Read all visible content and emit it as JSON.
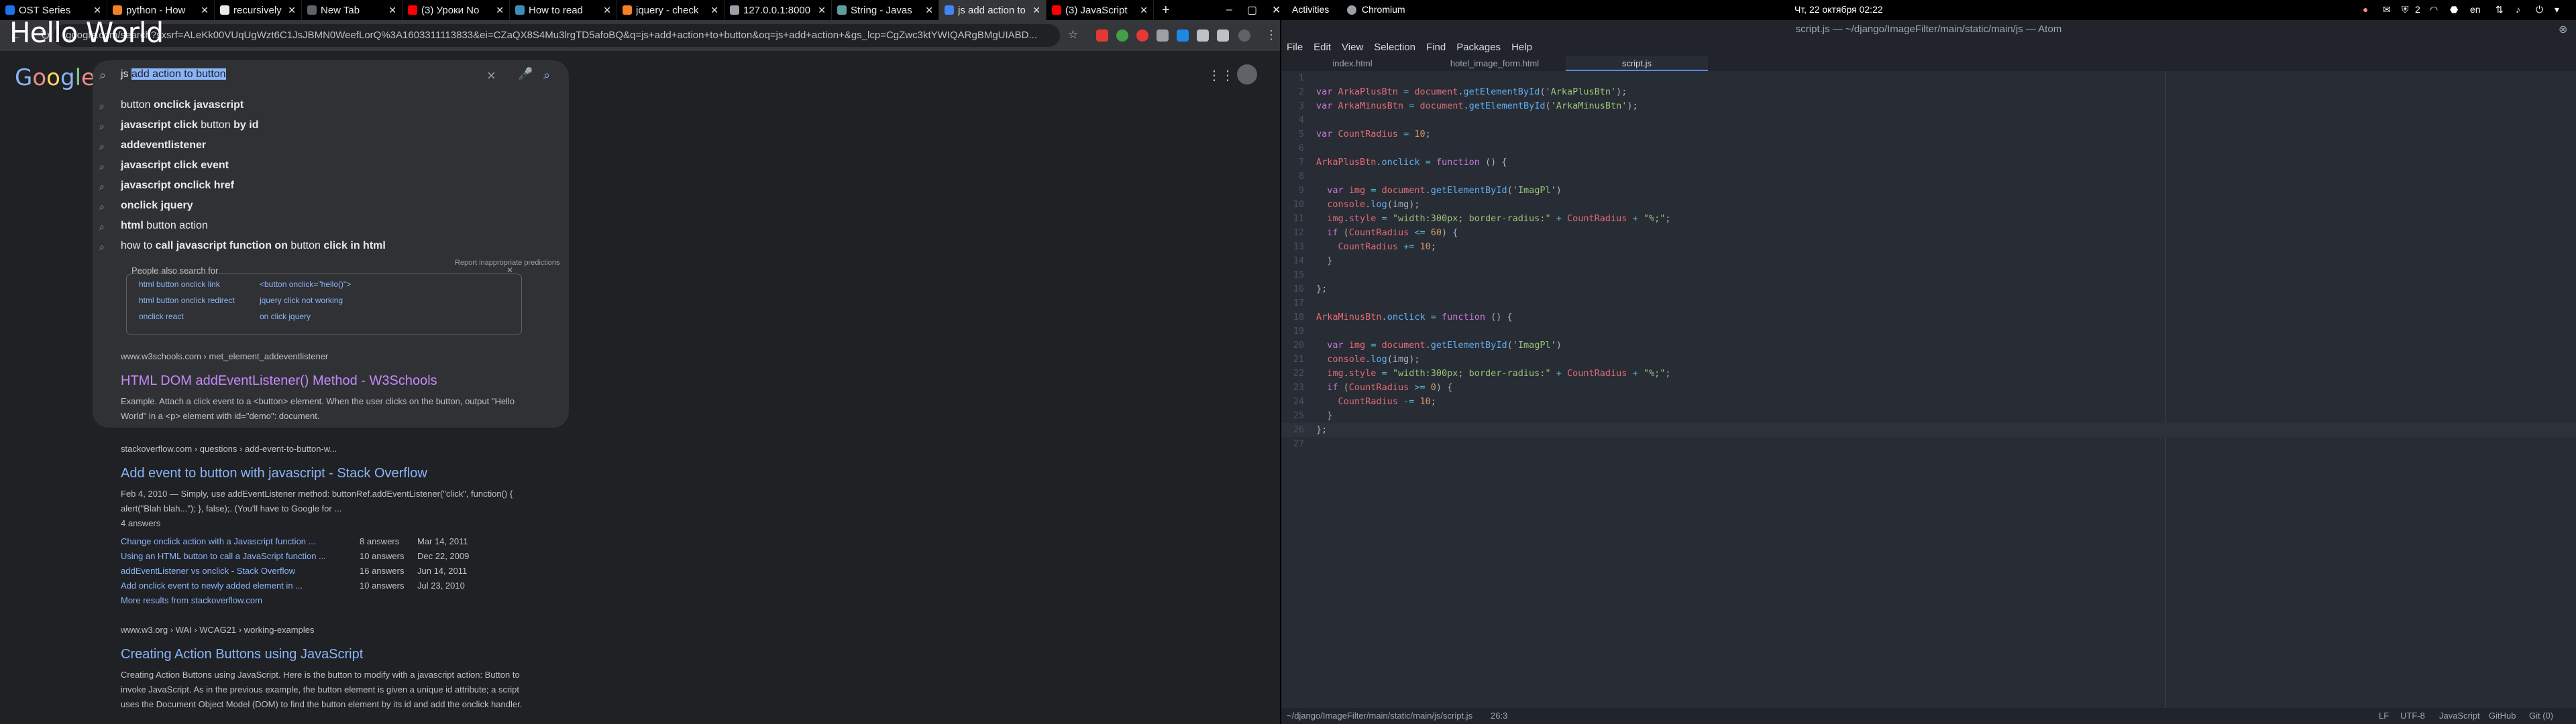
{
  "browser": {
    "tabs": [
      {
        "title": "OST Series",
        "fav": "#1a73e8"
      },
      {
        "title": "python - How",
        "fav": "#f48024"
      },
      {
        "title": "recursively fi",
        "fav": "#e8eaed"
      },
      {
        "title": "New Tab",
        "fav": "#5f6368"
      },
      {
        "title": "(3) Уроки No",
        "fav": "#ff0000"
      },
      {
        "title": "How to read",
        "fav": "#3c8dbc"
      },
      {
        "title": "jquery - check",
        "fav": "#f48024"
      },
      {
        "title": "127.0.0.1:8000",
        "fav": "#9aa0a6"
      },
      {
        "title": "String - Javas",
        "fav": "#5f9ea0"
      },
      {
        "title": "js add action to",
        "fav": "#4285f4"
      },
      {
        "title": "(3) JavaScript",
        "fav": "#ff0000"
      }
    ],
    "new_tab": "+",
    "omnibox_url": "google.com/search?sxsrf=ALeKk00VUqUgWzt6C1JsJBMN0WeefLorQ%3A1603311113833&ei=CZaQX8S4Mu3lrgTD5afoBQ&q=js+add+action+to+button&oq=js+add+action+&gs_lcp=CgZwc3ktYWIQARgBMgUIABD...",
    "overlay_text": "Hello World"
  },
  "google": {
    "logo": "Google",
    "query_prefix": "js",
    "query_rest": "add action to button",
    "suggestions": [
      {
        "plain": "button ",
        "bold": "onclick javascript"
      },
      {
        "plain": "",
        "bold": "javascript click",
        "plain2": " button ",
        "bold2": "by id"
      },
      {
        "plain": "",
        "bold": "addeventlistener"
      },
      {
        "plain": "",
        "bold": "javascript click event"
      },
      {
        "plain": "",
        "bold": "javascript onclick href"
      },
      {
        "plain": "",
        "bold": "onclick jquery"
      },
      {
        "plain": "",
        "bold": "html",
        "plain2": " button action"
      },
      {
        "plain": "how to ",
        "bold": "call javascript function on",
        "plain2": " button ",
        "bold2": "click in html"
      }
    ],
    "people_also_title": "People also search for",
    "report": "Report inappropriate predictions",
    "people_also": [
      "html button onclick link",
      "<button onclick=\"hello()\">",
      "html button onclick redirect",
      "jquery click not working",
      "onclick react",
      "on click jquery"
    ],
    "results": [
      {
        "url": "www.w3schools.com › met_element_addeventlistener",
        "title": "HTML DOM addEventListener() Method - W3Schools",
        "title_color": "#c58af9",
        "snippet": "Example. Attach a click event to a <button> element. When the user clicks on the button, output \"Hello World\" in a <p> element with id=\"demo\": document."
      },
      {
        "url": "stackoverflow.com › questions › add-event-to-button-w...",
        "title": "Add event to button with javascript - Stack Overflow",
        "title_color": "#8ab4f8",
        "snippet": "Feb 4, 2010 — Simply, use addEventListener method: buttonRef.addEventListener(\"click\", function() { alert(\"Blah blah...\"); }, false);. (You'll have to Google for ...",
        "answers_total": "4 answers",
        "sublinks": [
          {
            "text": "Change onclick action with a Javascript function ...",
            "answers": "8 answers",
            "date": "Mar 14, 2011"
          },
          {
            "text": "Using an HTML button to call a JavaScript function ...",
            "answers": "10 answers",
            "date": "Dec 22, 2009"
          },
          {
            "text": "addEventListener vs onclick - Stack Overflow",
            "answers": "16 answers",
            "date": "Jun 14, 2011"
          },
          {
            "text": "Add onclick event to newly added element in ...",
            "answers": "10 answers",
            "date": "Jul 23, 2010"
          }
        ],
        "more": "More results from stackoverflow.com"
      },
      {
        "url": "www.w3.org › WAI › WCAG21 › working-examples",
        "title": "Creating Action Buttons using JavaScript",
        "title_color": "#8ab4f8",
        "snippet": "Creating Action Buttons using JavaScript. Here is the button to modify with a javascript action: Button to invoke JavaScript. As in the previous example, the button element is given a unique id attribute; a script uses the Document Object Model (DOM) to find the button element by its id and add the onclick handler."
      }
    ]
  },
  "gnome": {
    "activities": "Activities",
    "app": "Chromium",
    "clock": "Чт, 22 октября  02:22",
    "lang": "en",
    "badge": "2"
  },
  "atom": {
    "title": "script.js — ~/django/ImageFilter/main/static/main/js — Atom",
    "menu": [
      "File",
      "Edit",
      "View",
      "Selection",
      "Find",
      "Packages",
      "Help"
    ],
    "tabs": [
      "index.html",
      "hotel_image_form.html",
      "script.js"
    ],
    "status_path": "~/django/ImageFilter/main/static/main/js/script.js",
    "status_pos": "26:3",
    "status_right": [
      "LF",
      "UTF-8",
      "JavaScript",
      "GitHub",
      "Git (0)"
    ]
  }
}
